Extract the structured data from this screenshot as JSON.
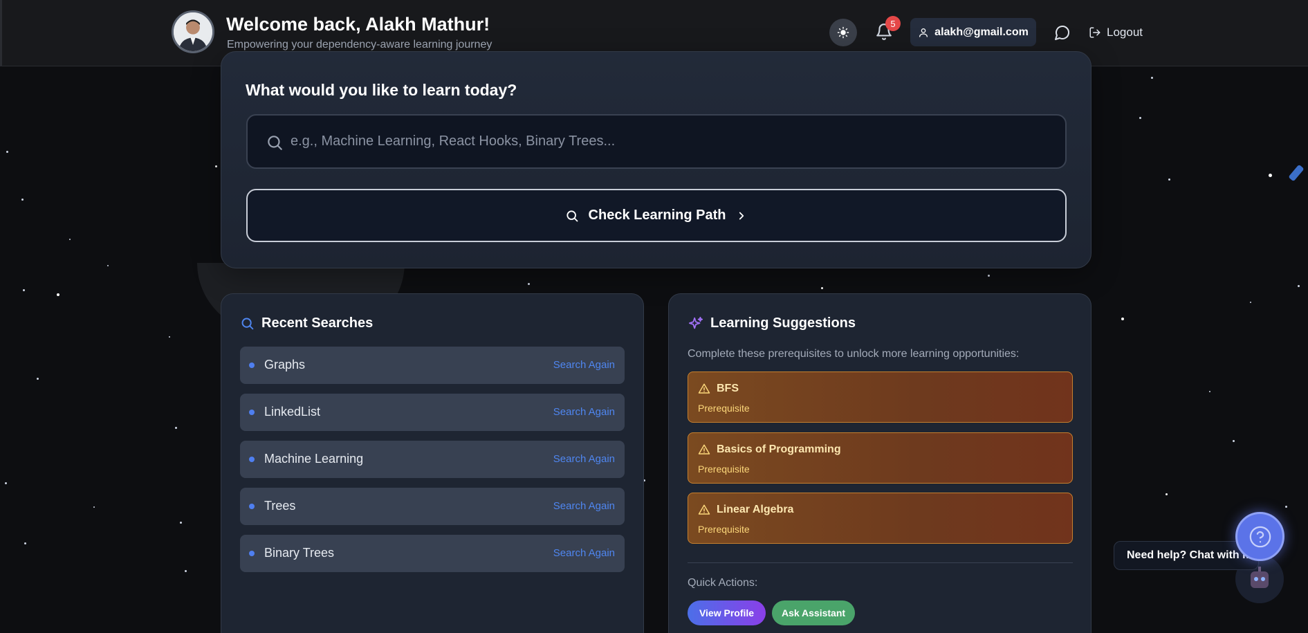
{
  "header": {
    "title": "Welcome back, Alakh Mathur!",
    "subtitle": "Empowering your dependency-aware learning journey",
    "notification_count": "5",
    "email": "alakh@gmail.com",
    "logout_label": "Logout"
  },
  "search": {
    "title": "What would you like to learn today?",
    "placeholder": "e.g., Machine Learning, React Hooks, Binary Trees...",
    "value": "",
    "button_label": "Check Learning Path"
  },
  "recent": {
    "title": "Recent Searches",
    "action_label": "Search Again",
    "items": [
      "Graphs",
      "LinkedList",
      "Machine Learning",
      "Trees",
      "Binary Trees"
    ]
  },
  "suggestions": {
    "title": "Learning Suggestions",
    "intro": "Complete these prerequisites to unlock more learning opportunities:",
    "items": [
      {
        "name": "BFS",
        "tag": "Prerequisite"
      },
      {
        "name": "Basics of Programming",
        "tag": "Prerequisite"
      },
      {
        "name": "Linear Algebra",
        "tag": "Prerequisite"
      }
    ],
    "quick_actions_label": "Quick Actions:",
    "view_profile_label": "View Profile",
    "ask_assistant_label": "Ask Assistant"
  },
  "help": {
    "bubble_text": "Need help? Chat with me"
  },
  "colors": {
    "accent_blue": "#4f86f0",
    "badge_red": "#e54848",
    "warning_orange": "#c7802e",
    "assist_green": "#4aa46a",
    "profile_gradient_start": "#4c6fe8",
    "profile_gradient_end": "#8a3fe8"
  },
  "icons": [
    "sun-icon",
    "bell-icon",
    "user-icon",
    "chat-icon",
    "logout-icon",
    "search-icon",
    "chevron-right-icon",
    "sparkles-icon",
    "warning-icon",
    "question-icon",
    "robot-icon"
  ]
}
